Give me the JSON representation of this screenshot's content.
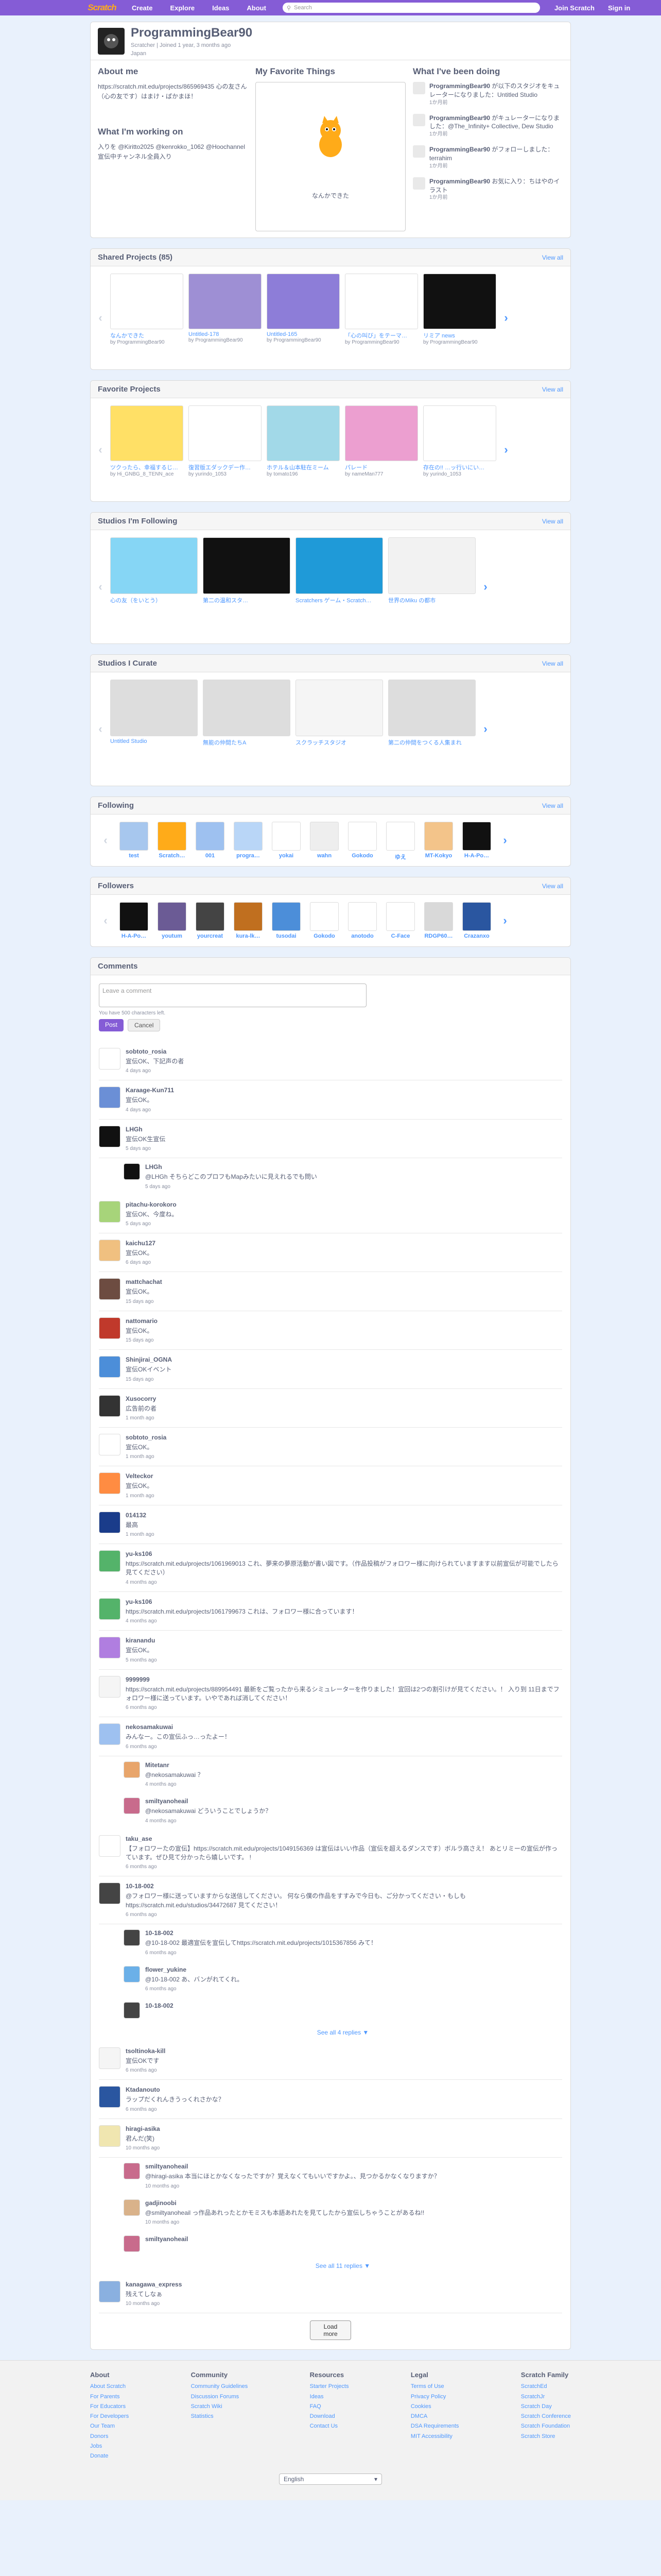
{
  "nav": {
    "logo": "Scratch",
    "create": "Create",
    "explore": "Explore",
    "ideas": "Ideas",
    "about": "About",
    "search_placeholder": "Search",
    "join": "Join Scratch",
    "signin": "Sign in"
  },
  "profile": {
    "username": "ProgrammingBear90",
    "sub": "Scratcher | Joined 1 year, 3 months ago",
    "country": "Japan",
    "about_title": "About me",
    "about_text": "https://scratch.mit.edu/projects/865969435 心の友さん（心の友です）はまけ・ぱかまほ！",
    "working_title": "What I'm working on",
    "working_text": "入りを @Kiritto2025 @kenrokko_1062 @Hoochannel 宣伝中チャンネル全員入り",
    "fav_title": "My Favorite Things",
    "fav_caption": "なんかできた",
    "doing_title": "What I've been doing",
    "doing": [
      {
        "who": "ProgrammingBear90",
        "text": "が以下のスタジオをキュレーターになりました：Untitled Studio",
        "when": "1か月前"
      },
      {
        "who": "ProgrammingBear90",
        "text": "がキュレーターになりました：@The_Infinity+ Collective, Dew Studio",
        "when": "1か月前"
      },
      {
        "who": "ProgrammingBear90",
        "text": "がフォローしました：terrahim",
        "when": "1か月前"
      },
      {
        "who": "ProgrammingBear90",
        "text": "お気に入り：ちはやのイラスト",
        "when": "1か月前"
      }
    ]
  },
  "shared": {
    "title": "Shared Projects (85)",
    "view_all": "View all",
    "items": [
      {
        "t": "なんかできた",
        "by": "by ProgrammingBear90",
        "c": "#ffffff"
      },
      {
        "t": "Untitled-178",
        "by": "by ProgrammingBear90",
        "c": "#9e8fd4"
      },
      {
        "t": "Untitled-165",
        "by": "by ProgrammingBear90",
        "c": "#8d7dd8"
      },
      {
        "t": "「心の叫び」をテーマ…",
        "by": "by ProgrammingBear90",
        "c": "#ffffff"
      },
      {
        "t": "リミア news",
        "by": "by ProgrammingBear90",
        "c": "#111111"
      }
    ]
  },
  "favorites": {
    "title": "Favorite Projects",
    "view_all": "View all",
    "items": [
      {
        "t": "ツクったら、幸福するじ…",
        "by": "by Hi_GNBG_8_TENN_ace",
        "c": "#ffe066"
      },
      {
        "t": "復習版エダックデー作…",
        "by": "by yurindo_1053",
        "c": "#ffffff"
      },
      {
        "t": "ホテル＆山本駐在ミーム",
        "by": "by tomato196",
        "c": "#a2d9e8"
      },
      {
        "t": "パレード",
        "by": "by nameMan777",
        "c": "#ec9fd0"
      },
      {
        "t": "存在の!! …ッ行いにい…",
        "by": "by yurindo_1053",
        "c": "#ffffff"
      }
    ]
  },
  "following_studios": {
    "title": "Studios I'm Following",
    "view_all": "View all",
    "items": [
      {
        "t": "心の友（をいとう）",
        "c": "#86d6f5"
      },
      {
        "t": "第二の温和スタ…",
        "c": "#111111"
      },
      {
        "t": "Scratchers ゲーム・Scratch…",
        "c": "#1f9ad8"
      },
      {
        "t": "世界のMiku の都市",
        "c": "#f2f2f2"
      }
    ]
  },
  "curated_studios": {
    "title": "Studios I Curate",
    "view_all": "View all",
    "items": [
      {
        "t": "Untitled Studio",
        "c": "#dddddd"
      },
      {
        "t": "無能の仲間たちA",
        "c": "#dddddd"
      },
      {
        "t": "スクラッチスタジオ",
        "c": "#f5f5f5"
      },
      {
        "t": "第二の仲間をつくる人集まれ",
        "c": "#dddddd"
      }
    ]
  },
  "following": {
    "title": "Following",
    "view_all": "View all",
    "items": [
      {
        "n": "test",
        "c": "#a7c7ee"
      },
      {
        "n": "Scratch…",
        "c": "#ffab19"
      },
      {
        "n": "001",
        "c": "#9ec1f0"
      },
      {
        "n": "progra…",
        "c": "#b9d6f7"
      },
      {
        "n": "yokai",
        "c": "#ffffff"
      },
      {
        "n": "wahn",
        "c": "#eeeeee"
      },
      {
        "n": "Gokodo",
        "c": "#ffffff"
      },
      {
        "n": "ゆえ",
        "c": "#ffffff"
      },
      {
        "n": "MT-Kokyo",
        "c": "#f3c48a"
      },
      {
        "n": "H-A-Po…",
        "c": "#111111"
      }
    ]
  },
  "followers": {
    "title": "Followers",
    "view_all": "View all",
    "items": [
      {
        "n": "H-A-Po…",
        "c": "#111111"
      },
      {
        "n": "youtum",
        "c": "#6b5b95"
      },
      {
        "n": "yourcreat",
        "c": "#444444"
      },
      {
        "n": "kura-lk…",
        "c": "#c06f1f"
      },
      {
        "n": "tusodai",
        "c": "#4c8ed9"
      },
      {
        "n": "Gokodo",
        "c": "#ffffff"
      },
      {
        "n": "anotodo",
        "c": "#ffffff"
      },
      {
        "n": "C-Face",
        "c": "#ffffff"
      },
      {
        "n": "RDGP60…",
        "c": "#d9d9d9"
      },
      {
        "n": "Crazanxo",
        "c": "#2a56a0"
      }
    ]
  },
  "comments": {
    "title": "Comments",
    "placeholder": "Leave a comment",
    "limit": "You have 500 characters left.",
    "post": "Post",
    "cancel": "Cancel",
    "reply_label": "Reply",
    "list": [
      {
        "n": "sobtoto_rosia",
        "t": "宣伝OK、下記声の者",
        "d": "4 days ago",
        "c": "#ffffff",
        "replies": []
      },
      {
        "n": "Karaage-Kun711",
        "t": "宣伝OK。",
        "d": "4 days ago",
        "c": "#6b8fd6",
        "replies": []
      },
      {
        "n": "LHGh",
        "t": "宣伝OK生宣伝",
        "d": "5 days ago",
        "c": "#111111",
        "replies": [
          {
            "n": "LHGh",
            "t": "@LHGh そちらどこのプロフもMapみたいに見えれるでも問い",
            "d": "5 days ago",
            "c": "#111111"
          }
        ]
      },
      {
        "n": "pitachu-korokoro",
        "t": "宣伝OK、今度ね。",
        "d": "5 days ago",
        "c": "#a7d47a",
        "replies": []
      },
      {
        "n": "kaichu127",
        "t": "宣伝OK。",
        "d": "6 days ago",
        "c": "#f0c080",
        "replies": []
      },
      {
        "n": "mattchachat",
        "t": "宣伝OK。",
        "d": "15 days ago",
        "c": "#6d4c41",
        "replies": []
      },
      {
        "n": "nattomario",
        "t": "宣伝OK。",
        "d": "15 days ago",
        "c": "#c0392b",
        "replies": []
      },
      {
        "n": "Shinjirai_OGNA",
        "t": "宣伝OKイベント",
        "d": "15 days ago",
        "c": "#4c8ed9",
        "replies": []
      },
      {
        "n": "Xusocorry",
        "t": "広告前の者",
        "d": "1 month ago",
        "c": "#333333",
        "replies": []
      },
      {
        "n": "sobtoto_rosia",
        "t": "宣伝OK。",
        "d": "1 month ago",
        "c": "#ffffff",
        "replies": []
      },
      {
        "n": "Velteckor",
        "t": "宣伝OK。",
        "d": "1 month ago",
        "c": "#ff8c42",
        "replies": []
      },
      {
        "n": "014132",
        "t": "最高",
        "d": "1 month ago",
        "c": "#1a3c8a",
        "replies": []
      },
      {
        "n": "yu-ks106",
        "t": "https://scratch.mit.edu/projects/1061969013 これ、夢来の夢原活動が書い図です。（作品投稿がフォロワー様に向けられていますます以前宣伝が可能でしたら見てください）",
        "d": "4 months ago",
        "c": "#54b36a",
        "replies": []
      },
      {
        "n": "yu-ks106",
        "t": "https://scratch.mit.edu/projects/1061799673 これは、フォロワー様に合っています！",
        "d": "4 months ago",
        "c": "#54b36a",
        "replies": []
      },
      {
        "n": "kiranandu",
        "t": "宣伝OK。",
        "d": "5 months ago",
        "c": "#b07ee0",
        "replies": []
      },
      {
        "n": "9999999",
        "t": "https://scratch.mit.edu/projects/889954491 最新をご覧ったから来るシミュレーターを作りました！宜回は2つの割引けが見てください。！ 入り到 11日までフォロワー様に送っています。いやであれば消してください！",
        "d": "6 months ago",
        "c": "#f5f5f5",
        "replies": []
      },
      {
        "n": "nekosamakuwai",
        "t": "みんなー。この宣伝ふっ…ったよー！",
        "d": "6 months ago",
        "c": "#9ec1f0",
        "replies": [
          {
            "n": "Mitetanr",
            "t": "@nekosamakuwai ？",
            "d": "4 months ago",
            "c": "#e8a56b"
          },
          {
            "n": "smiltyanoheail",
            "t": "@nekosamakuwai どういうことでしょうか？",
            "d": "4 months ago",
            "c": "#c86b8c"
          }
        ]
      },
      {
        "n": "taku_ase",
        "t": "【フォロワーたの宣伝】https://scratch.mit.edu/projects/1049156369 は宣伝はいい作品（宣伝を超えるダンスです）ボルラ高さえ！ あとリミーの宣伝が作っています。ぜひ見て分かったら嬉しいです。 !",
        "d": "6 months ago",
        "c": "#ffffff",
        "replies": []
      },
      {
        "n": "10-18-002",
        "t": "@フォロワー様に送っていますからな送信してください。 何なら僕の作品をすすみで今日も、ご分かってください・もしもhttps://scratch.mit.edu/studios/34472687 見てください！",
        "d": "6 months ago",
        "c": "#444444",
        "replies": [
          {
            "n": "10-18-002",
            "t": "@10-18-002 最適宣伝を宣伝してhttps://scratch.mit.edu/projects/1015367856 みて！",
            "d": "6 months ago",
            "c": "#444444"
          },
          {
            "n": "flower_yukine",
            "t": "@10-18-002 あ、バンがれてくれ。",
            "d": "6 months ago",
            "c": "#6bb0e8"
          },
          {
            "n": "10-18-002",
            "t": "",
            "d": "",
            "c": "#444444"
          }
        ],
        "more": "See all 4 replies ▼"
      },
      {
        "n": "tsoltinoka-kill",
        "t": "宣伝OKです",
        "d": "6 months ago",
        "c": "#f5f5f5",
        "replies": []
      },
      {
        "n": "Ktadanouto",
        "t": "ラップだくれんきうっくれさかな？",
        "d": "6 months ago",
        "c": "#2a56a0",
        "replies": []
      },
      {
        "n": "hiragi-asika",
        "t": "君んだ(笑)",
        "d": "10 months ago",
        "c": "#f0e6b0",
        "replies": [
          {
            "n": "smiltyanoheail",
            "t": "@hiragi-asika 本当にほとかなくなったですか？覚えなくてもいいですかよ。、見つかるかなくなりますか？",
            "d": "10 months ago",
            "c": "#c86b8c"
          },
          {
            "n": "gadjinoobi",
            "t": "@smiltyanoheail っ作品あれったとかモミスも本語あれたを見てしたから宣伝しちゃうことがあるね!!",
            "d": "10 months ago",
            "c": "#d9b28a"
          },
          {
            "n": "smiltyanoheail",
            "t": "",
            "d": "",
            "c": "#c86b8c"
          }
        ],
        "more": "See all 11 replies ▼"
      },
      {
        "n": "kanagawa_express",
        "t": "残えてしなぁ",
        "d": "10 months ago",
        "c": "#8ab0e0",
        "replies": []
      }
    ],
    "load_more": "Load more"
  },
  "footer": {
    "cols": [
      {
        "h": "About",
        "items": [
          "About Scratch",
          "For Parents",
          "For Educators",
          "For Developers",
          "Our Team",
          "Donors",
          "Jobs",
          "Donate"
        ]
      },
      {
        "h": "Community",
        "items": [
          "Community Guidelines",
          "Discussion Forums",
          "Scratch Wiki",
          "Statistics"
        ]
      },
      {
        "h": "Resources",
        "items": [
          "Starter Projects",
          "Ideas",
          "FAQ",
          "Download",
          "Contact Us"
        ]
      },
      {
        "h": "Legal",
        "items": [
          "Terms of Use",
          "Privacy Policy",
          "Cookies",
          "DMCA",
          "DSA Requirements",
          "MIT Accessibility"
        ]
      },
      {
        "h": "Scratch Family",
        "items": [
          "ScratchEd",
          "ScratchJr",
          "Scratch Day",
          "Scratch Conference",
          "Scratch Foundation",
          "Scratch Store"
        ]
      }
    ],
    "language": "English"
  }
}
